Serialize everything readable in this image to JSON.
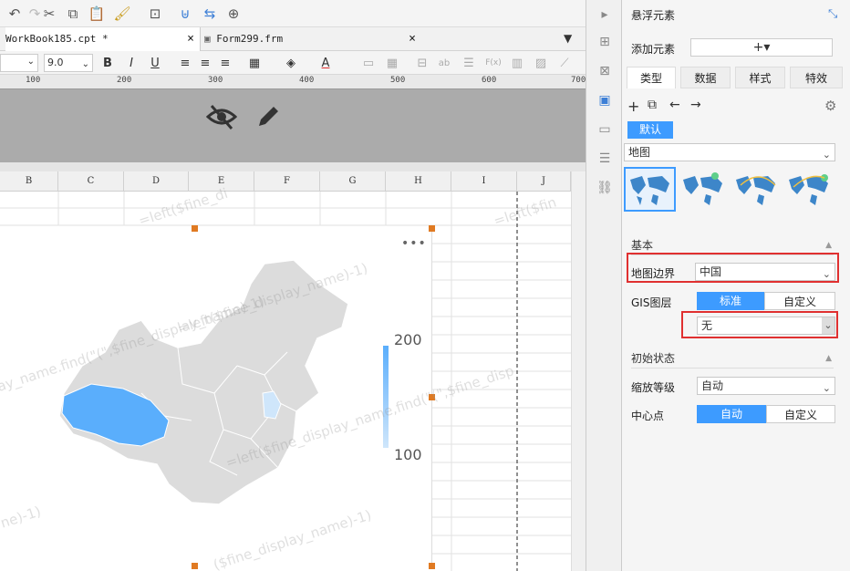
{
  "toolbar": {
    "icons": [
      "redo-icon",
      "cut-icon",
      "copy-icon",
      "paste-icon",
      "format-painter-icon",
      "insert-icon",
      "merge-icon",
      "swap-icon",
      "zoom-icon"
    ]
  },
  "tabs": [
    {
      "label": "WorkBook185.cpt *"
    },
    {
      "label": "Form299.frm"
    }
  ],
  "format": {
    "font_size": "9.0",
    "bold": "B",
    "italic": "I",
    "underline": "U",
    "text_color": "A",
    "fx": "F(x)",
    "ab": "ab"
  },
  "ruler": {
    "ticks": [
      "100",
      "200",
      "300",
      "400",
      "500",
      "600",
      "700"
    ]
  },
  "columns": [
    "B",
    "C",
    "D",
    "E",
    "F",
    "G",
    "H",
    "I",
    "J"
  ],
  "watermarks": [
    "=left($fine_di",
    "=left($fin",
    "ay_name.find(\"(\",$fine_display_name)-1)",
    "=left($fine_display_name,find(\"(\",$fine_disp",
    "ne)-1)",
    "=left($fine_display_name)-1)",
    "($fine_display_name)-1)"
  ],
  "chart_data": {
    "type": "map",
    "legend": {
      "max": "200",
      "min": "100"
    },
    "highlight_color": "#5aaefc",
    "base_color": "#dcdcdc"
  },
  "side_icons": [
    "arrow-right-icon",
    "layout-icon",
    "widget-icon",
    "float-element-icon",
    "dropdown-icon",
    "layer-icon",
    "link-icon"
  ],
  "panel": {
    "title": "悬浮元素",
    "add_element_label": "添加元素",
    "add_button": "+▾",
    "tabs": [
      "类型",
      "数据",
      "样式",
      "特效"
    ],
    "default_label": "默认",
    "map_type": "地图",
    "section_basic": "基本",
    "map_boundary_label": "地图边界",
    "map_boundary_value": "中国",
    "gis_label": "GIS图层",
    "gis_standard": "标准",
    "gis_custom": "自定义",
    "gis_value": "无",
    "section_initial": "初始状态",
    "zoom_label": "缩放等级",
    "zoom_value": "自动",
    "center_label": "中心点",
    "center_auto": "自动",
    "center_custom": "自定义"
  },
  "colors": {
    "accent": "#3d9bff",
    "red": "#e03030"
  }
}
